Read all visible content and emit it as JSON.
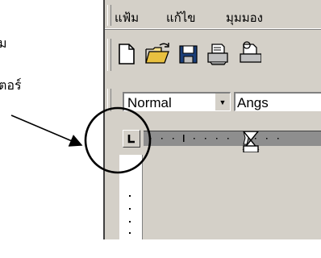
{
  "annotation": {
    "line1": "ม",
    "line2": "ตอร์"
  },
  "menu": {
    "items": [
      {
        "label": "แฟ้ม"
      },
      {
        "label": "แก้ไข"
      },
      {
        "label": "มุมมอง"
      }
    ]
  },
  "toolbar": {
    "buttons": [
      {
        "icon": "new-document-icon"
      },
      {
        "icon": "open-folder-icon"
      },
      {
        "icon": "save-icon"
      },
      {
        "icon": "print-icon"
      },
      {
        "icon": "print-preview-icon"
      }
    ]
  },
  "formatting": {
    "style_value": "Normal",
    "font_value": "Angs"
  },
  "ruler": {
    "tab_selector": "left-tab-icon"
  }
}
